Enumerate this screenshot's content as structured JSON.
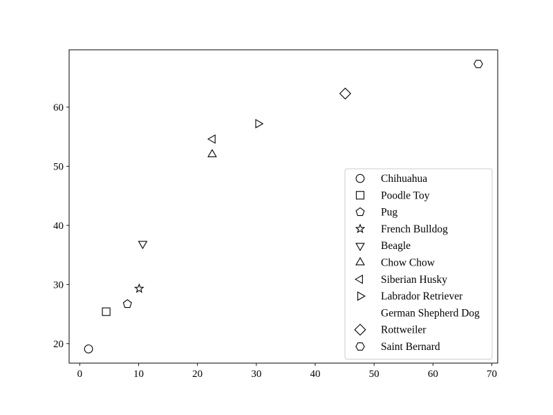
{
  "chart_data": {
    "type": "scatter",
    "title": "",
    "xlabel": "",
    "ylabel": "",
    "xlim": [
      -1.8,
      71.0
    ],
    "ylim": [
      16.7,
      69.7
    ],
    "grid": false,
    "xticks": [
      0,
      10,
      20,
      30,
      40,
      50,
      60,
      70
    ],
    "yticks": [
      20,
      30,
      40,
      50,
      60
    ],
    "xtick_labels": [
      "0",
      "10",
      "20",
      "30",
      "40",
      "50",
      "60",
      "70"
    ],
    "ytick_labels": [
      "20",
      "30",
      "40",
      "50",
      "60"
    ],
    "legend_position": "lower-right",
    "marker_color": "#000000",
    "series": [
      {
        "name": "Chihuahua",
        "marker": "circle",
        "x": [
          1.5
        ],
        "y": [
          19.1
        ]
      },
      {
        "name": "Poodle Toy",
        "marker": "square",
        "x": [
          4.5
        ],
        "y": [
          25.4
        ]
      },
      {
        "name": "Pug",
        "marker": "pentagon",
        "x": [
          8.1
        ],
        "y": [
          26.7
        ]
      },
      {
        "name": "French Bulldog",
        "marker": "star",
        "x": [
          10.1
        ],
        "y": [
          29.3
        ]
      },
      {
        "name": "Beagle",
        "marker": "triangle-down",
        "x": [
          10.7
        ],
        "y": [
          36.9
        ]
      },
      {
        "name": "Chow Chow",
        "marker": "triangle-up",
        "x": [
          22.5
        ],
        "y": [
          52.0
        ]
      },
      {
        "name": "Siberian Husky",
        "marker": "triangle-left",
        "x": [
          22.6
        ],
        "y": [
          54.6
        ]
      },
      {
        "name": "Labrador Retriever",
        "marker": "triangle-right",
        "x": [
          30.3
        ],
        "y": [
          57.2
        ]
      },
      {
        "name": "German Shepherd Dog",
        "marker": "none",
        "x": [],
        "y": []
      },
      {
        "name": "Rottweiler",
        "marker": "diamond",
        "x": [
          45.1
        ],
        "y": [
          62.3
        ]
      },
      {
        "name": "Saint Bernard",
        "marker": "hexagon",
        "x": [
          67.7
        ],
        "y": [
          67.3
        ]
      }
    ]
  }
}
